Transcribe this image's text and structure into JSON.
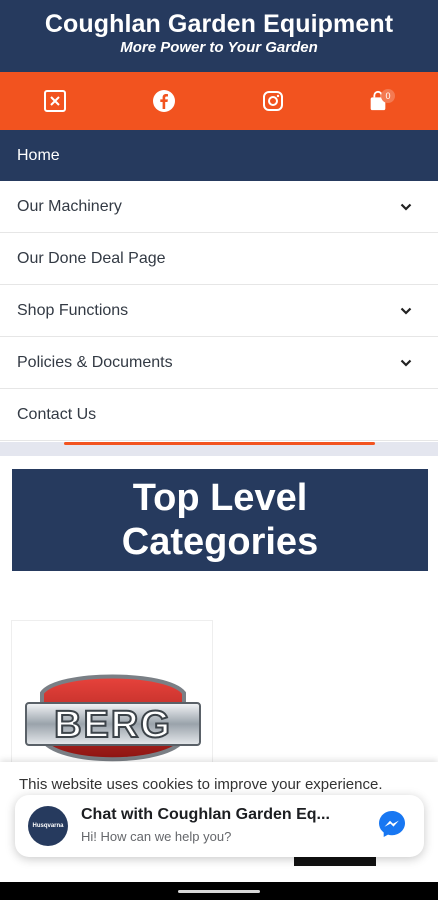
{
  "header": {
    "title": "Coughlan Garden Equipment",
    "tagline": "More Power to Your Garden"
  },
  "iconbar": {
    "icons": [
      "x-twitter-icon",
      "facebook-icon",
      "instagram-icon",
      "shopping-bag-icon"
    ],
    "cart_count": "0"
  },
  "menu": {
    "items": [
      {
        "label": "Home",
        "active": true
      },
      {
        "label": "Our Machinery",
        "has_submenu": true
      },
      {
        "label": "Our Done Deal Page"
      },
      {
        "label": "Shop Functions",
        "has_submenu": true
      },
      {
        "label": "Policies & Documents",
        "has_submenu": true
      },
      {
        "label": "Contact Us"
      }
    ]
  },
  "banner": {
    "line1": "Top Level",
    "line2": "Categories"
  },
  "category_card": {
    "logo_text": "BERG"
  },
  "cookie": {
    "text": "This website uses cookies to improve your experience."
  },
  "chat": {
    "name": "Chat with Coughlan Garden Eq...",
    "subtitle": "Hi! How can we help you?",
    "avatar_text": "Husqvarna"
  },
  "colors": {
    "navy": "#263a5e",
    "orange": "#f2531f"
  }
}
